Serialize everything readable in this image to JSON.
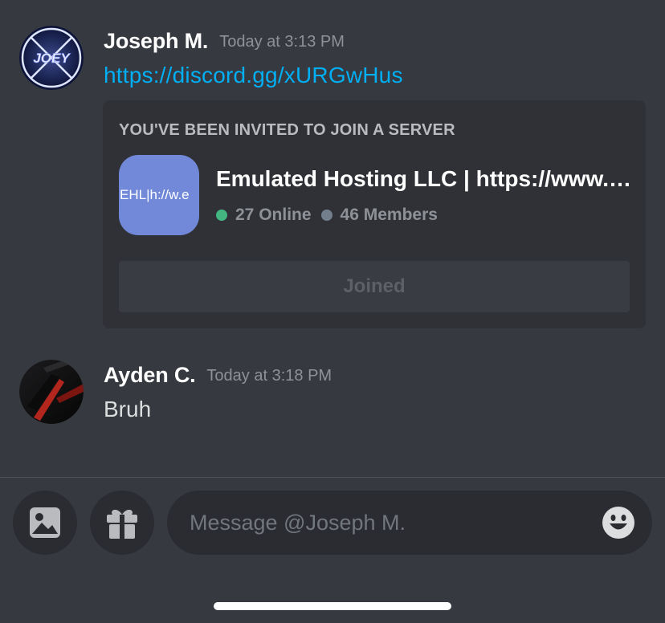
{
  "messages": [
    {
      "author": "Joseph M.",
      "timestamp": "Today at 3:13 PM",
      "avatar_text": "JOEY",
      "link": "https://discord.gg/xURGwHus"
    },
    {
      "author": "Ayden C.",
      "timestamp": "Today at 3:18 PM",
      "text": "Bruh"
    }
  ],
  "invite": {
    "heading": "YOU'VE BEEN INVITED TO JOIN A SERVER",
    "server_icon_text": "EHL|h://w.e",
    "server_name": "Emulated Hosting LLC | https://www.emulatedhosting.com",
    "online": "27 Online",
    "members": "46 Members",
    "button_label": "Joined"
  },
  "composer": {
    "placeholder": "Message @Joseph M."
  },
  "icons": {
    "image_button": "image-icon",
    "gift_button": "gift-icon",
    "emoji_button": "emoji-icon"
  },
  "colors": {
    "background": "#36393f",
    "link": "#00aff4",
    "online": "#43b581",
    "server_icon": "#7289da"
  }
}
